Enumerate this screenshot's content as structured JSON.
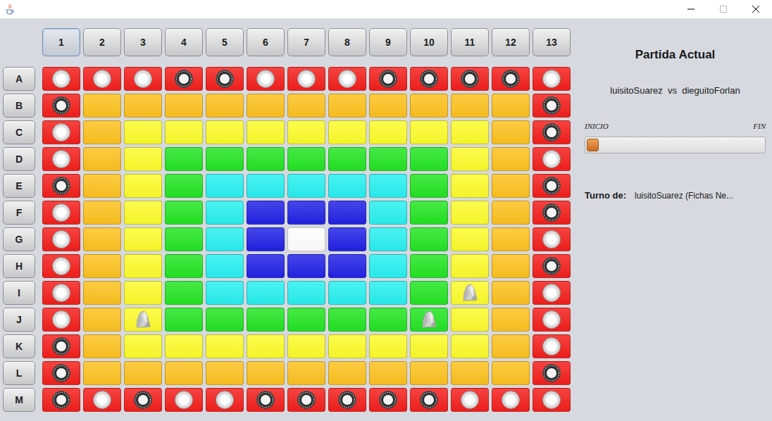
{
  "window": {
    "title": ""
  },
  "columns": [
    {
      "label": "1",
      "focused": true
    },
    {
      "label": "2",
      "focused": false
    },
    {
      "label": "3",
      "focused": false
    },
    {
      "label": "4",
      "focused": false
    },
    {
      "label": "5",
      "focused": false
    },
    {
      "label": "6",
      "focused": false
    },
    {
      "label": "7",
      "focused": false
    },
    {
      "label": "8",
      "focused": false
    },
    {
      "label": "9",
      "focused": false
    },
    {
      "label": "10",
      "focused": false
    },
    {
      "label": "11",
      "focused": false
    },
    {
      "label": "12",
      "focused": false
    },
    {
      "label": "13",
      "focused": false
    }
  ],
  "rows": [
    {
      "label": "A",
      "cells": [
        {
          "color": "#f41f1c",
          "piece": "white"
        },
        {
          "color": "#f41f1c",
          "piece": "white"
        },
        {
          "color": "#f41f1c",
          "piece": "white"
        },
        {
          "color": "#f41f1c",
          "piece": "black"
        },
        {
          "color": "#f41f1c",
          "piece": "black"
        },
        {
          "color": "#f41f1c",
          "piece": "white"
        },
        {
          "color": "#f41f1c",
          "piece": "white"
        },
        {
          "color": "#f41f1c",
          "piece": "white"
        },
        {
          "color": "#f41f1c",
          "piece": "black"
        },
        {
          "color": "#f41f1c",
          "piece": "black"
        },
        {
          "color": "#f41f1c",
          "piece": "black"
        },
        {
          "color": "#f41f1c",
          "piece": "black"
        },
        {
          "color": "#f41f1c",
          "piece": "white"
        }
      ]
    },
    {
      "label": "B",
      "cells": [
        {
          "color": "#f41f1c",
          "piece": "black"
        },
        {
          "color": "#fec21f",
          "piece": "none"
        },
        {
          "color": "#fec21f",
          "piece": "none"
        },
        {
          "color": "#fec21f",
          "piece": "none"
        },
        {
          "color": "#fec21f",
          "piece": "none"
        },
        {
          "color": "#fec21f",
          "piece": "none"
        },
        {
          "color": "#fec21f",
          "piece": "none"
        },
        {
          "color": "#fec21f",
          "piece": "none"
        },
        {
          "color": "#fec21f",
          "piece": "none"
        },
        {
          "color": "#fec21f",
          "piece": "none"
        },
        {
          "color": "#fec21f",
          "piece": "none"
        },
        {
          "color": "#fec21f",
          "piece": "none"
        },
        {
          "color": "#f41f1c",
          "piece": "black"
        }
      ]
    },
    {
      "label": "C",
      "cells": [
        {
          "color": "#f41f1c",
          "piece": "white"
        },
        {
          "color": "#fec21f",
          "piece": "none"
        },
        {
          "color": "#fdfc2b",
          "piece": "none"
        },
        {
          "color": "#fdfc2b",
          "piece": "none"
        },
        {
          "color": "#fdfc2b",
          "piece": "none"
        },
        {
          "color": "#fdfc2b",
          "piece": "none"
        },
        {
          "color": "#fdfc2b",
          "piece": "none"
        },
        {
          "color": "#fdfc2b",
          "piece": "none"
        },
        {
          "color": "#fdfc2b",
          "piece": "none"
        },
        {
          "color": "#fdfc2b",
          "piece": "none"
        },
        {
          "color": "#fdfc2b",
          "piece": "none"
        },
        {
          "color": "#fec21f",
          "piece": "none"
        },
        {
          "color": "#f41f1c",
          "piece": "black"
        }
      ]
    },
    {
      "label": "D",
      "cells": [
        {
          "color": "#f41f1c",
          "piece": "white"
        },
        {
          "color": "#fec21f",
          "piece": "none"
        },
        {
          "color": "#fdfc2b",
          "piece": "none"
        },
        {
          "color": "#23e523",
          "piece": "none"
        },
        {
          "color": "#23e523",
          "piece": "none"
        },
        {
          "color": "#23e523",
          "piece": "none"
        },
        {
          "color": "#23e523",
          "piece": "none"
        },
        {
          "color": "#23e523",
          "piece": "none"
        },
        {
          "color": "#23e523",
          "piece": "none"
        },
        {
          "color": "#23e523",
          "piece": "none"
        },
        {
          "color": "#fdfc2b",
          "piece": "none"
        },
        {
          "color": "#fec21f",
          "piece": "none"
        },
        {
          "color": "#f41f1c",
          "piece": "white"
        }
      ]
    },
    {
      "label": "E",
      "cells": [
        {
          "color": "#f41f1c",
          "piece": "black"
        },
        {
          "color": "#fec21f",
          "piece": "none"
        },
        {
          "color": "#fdfc2b",
          "piece": "none"
        },
        {
          "color": "#23e523",
          "piece": "none"
        },
        {
          "color": "#29f0f0",
          "piece": "none"
        },
        {
          "color": "#29f0f0",
          "piece": "none"
        },
        {
          "color": "#29f0f0",
          "piece": "none"
        },
        {
          "color": "#29f0f0",
          "piece": "none"
        },
        {
          "color": "#29f0f0",
          "piece": "none"
        },
        {
          "color": "#23e523",
          "piece": "none"
        },
        {
          "color": "#fdfc2b",
          "piece": "none"
        },
        {
          "color": "#fec21f",
          "piece": "none"
        },
        {
          "color": "#f41f1c",
          "piece": "black"
        }
      ]
    },
    {
      "label": "F",
      "cells": [
        {
          "color": "#f41f1c",
          "piece": "white"
        },
        {
          "color": "#fec21f",
          "piece": "none"
        },
        {
          "color": "#fdfc2b",
          "piece": "none"
        },
        {
          "color": "#23e523",
          "piece": "none"
        },
        {
          "color": "#29f0f0",
          "piece": "none"
        },
        {
          "color": "#2222e6",
          "piece": "none"
        },
        {
          "color": "#2222e6",
          "piece": "none"
        },
        {
          "color": "#2222e6",
          "piece": "none"
        },
        {
          "color": "#29f0f0",
          "piece": "none"
        },
        {
          "color": "#23e523",
          "piece": "none"
        },
        {
          "color": "#fdfc2b",
          "piece": "none"
        },
        {
          "color": "#fec21f",
          "piece": "none"
        },
        {
          "color": "#f41f1c",
          "piece": "black"
        }
      ]
    },
    {
      "label": "G",
      "cells": [
        {
          "color": "#f41f1c",
          "piece": "white"
        },
        {
          "color": "#fec21f",
          "piece": "none"
        },
        {
          "color": "#fdfc2b",
          "piece": "none"
        },
        {
          "color": "#23e523",
          "piece": "none"
        },
        {
          "color": "#29f0f0",
          "piece": "none"
        },
        {
          "color": "#2222e6",
          "piece": "none"
        },
        {
          "color": "#ffffff",
          "piece": "none"
        },
        {
          "color": "#2222e6",
          "piece": "none"
        },
        {
          "color": "#29f0f0",
          "piece": "none"
        },
        {
          "color": "#23e523",
          "piece": "none"
        },
        {
          "color": "#fdfc2b",
          "piece": "none"
        },
        {
          "color": "#fec21f",
          "piece": "none"
        },
        {
          "color": "#f41f1c",
          "piece": "white"
        }
      ]
    },
    {
      "label": "H",
      "cells": [
        {
          "color": "#f41f1c",
          "piece": "white"
        },
        {
          "color": "#fec21f",
          "piece": "none"
        },
        {
          "color": "#fdfc2b",
          "piece": "none"
        },
        {
          "color": "#23e523",
          "piece": "none"
        },
        {
          "color": "#29f0f0",
          "piece": "none"
        },
        {
          "color": "#2222e6",
          "piece": "none"
        },
        {
          "color": "#2222e6",
          "piece": "none"
        },
        {
          "color": "#2222e6",
          "piece": "none"
        },
        {
          "color": "#29f0f0",
          "piece": "none"
        },
        {
          "color": "#23e523",
          "piece": "none"
        },
        {
          "color": "#fdfc2b",
          "piece": "none"
        },
        {
          "color": "#fec21f",
          "piece": "none"
        },
        {
          "color": "#f41f1c",
          "piece": "black"
        }
      ]
    },
    {
      "label": "I",
      "cells": [
        {
          "color": "#f41f1c",
          "piece": "white"
        },
        {
          "color": "#fec21f",
          "piece": "none"
        },
        {
          "color": "#fdfc2b",
          "piece": "none"
        },
        {
          "color": "#23e523",
          "piece": "none"
        },
        {
          "color": "#29f0f0",
          "piece": "none"
        },
        {
          "color": "#29f0f0",
          "piece": "none"
        },
        {
          "color": "#29f0f0",
          "piece": "none"
        },
        {
          "color": "#29f0f0",
          "piece": "none"
        },
        {
          "color": "#29f0f0",
          "piece": "none"
        },
        {
          "color": "#23e523",
          "piece": "none"
        },
        {
          "color": "#fdfc2b",
          "piece": "stone"
        },
        {
          "color": "#fec21f",
          "piece": "none"
        },
        {
          "color": "#f41f1c",
          "piece": "white"
        }
      ]
    },
    {
      "label": "J",
      "cells": [
        {
          "color": "#f41f1c",
          "piece": "white"
        },
        {
          "color": "#fec21f",
          "piece": "none"
        },
        {
          "color": "#fdfc2b",
          "piece": "stone"
        },
        {
          "color": "#23e523",
          "piece": "none"
        },
        {
          "color": "#23e523",
          "piece": "none"
        },
        {
          "color": "#23e523",
          "piece": "none"
        },
        {
          "color": "#23e523",
          "piece": "none"
        },
        {
          "color": "#23e523",
          "piece": "none"
        },
        {
          "color": "#23e523",
          "piece": "none"
        },
        {
          "color": "#23e523",
          "piece": "stone"
        },
        {
          "color": "#fdfc2b",
          "piece": "none"
        },
        {
          "color": "#fec21f",
          "piece": "none"
        },
        {
          "color": "#f41f1c",
          "piece": "white"
        }
      ]
    },
    {
      "label": "K",
      "cells": [
        {
          "color": "#f41f1c",
          "piece": "black"
        },
        {
          "color": "#fec21f",
          "piece": "none"
        },
        {
          "color": "#fdfc2b",
          "piece": "none"
        },
        {
          "color": "#fdfc2b",
          "piece": "none"
        },
        {
          "color": "#fdfc2b",
          "piece": "none"
        },
        {
          "color": "#fdfc2b",
          "piece": "none"
        },
        {
          "color": "#fdfc2b",
          "piece": "none"
        },
        {
          "color": "#fdfc2b",
          "piece": "none"
        },
        {
          "color": "#fdfc2b",
          "piece": "none"
        },
        {
          "color": "#fdfc2b",
          "piece": "none"
        },
        {
          "color": "#fdfc2b",
          "piece": "none"
        },
        {
          "color": "#fec21f",
          "piece": "none"
        },
        {
          "color": "#f41f1c",
          "piece": "white"
        }
      ]
    },
    {
      "label": "L",
      "cells": [
        {
          "color": "#f41f1c",
          "piece": "black"
        },
        {
          "color": "#fec21f",
          "piece": "none"
        },
        {
          "color": "#fec21f",
          "piece": "none"
        },
        {
          "color": "#fec21f",
          "piece": "none"
        },
        {
          "color": "#fec21f",
          "piece": "none"
        },
        {
          "color": "#fec21f",
          "piece": "none"
        },
        {
          "color": "#fec21f",
          "piece": "none"
        },
        {
          "color": "#fec21f",
          "piece": "none"
        },
        {
          "color": "#fec21f",
          "piece": "none"
        },
        {
          "color": "#fec21f",
          "piece": "none"
        },
        {
          "color": "#fec21f",
          "piece": "none"
        },
        {
          "color": "#fec21f",
          "piece": "none"
        },
        {
          "color": "#f41f1c",
          "piece": "black"
        }
      ]
    },
    {
      "label": "M",
      "cells": [
        {
          "color": "#f41f1c",
          "piece": "black"
        },
        {
          "color": "#f41f1c",
          "piece": "white"
        },
        {
          "color": "#f41f1c",
          "piece": "black"
        },
        {
          "color": "#f41f1c",
          "piece": "white"
        },
        {
          "color": "#f41f1c",
          "piece": "white"
        },
        {
          "color": "#f41f1c",
          "piece": "black"
        },
        {
          "color": "#f41f1c",
          "piece": "black"
        },
        {
          "color": "#f41f1c",
          "piece": "black"
        },
        {
          "color": "#f41f1c",
          "piece": "black"
        },
        {
          "color": "#f41f1c",
          "piece": "black"
        },
        {
          "color": "#f41f1c",
          "piece": "white"
        },
        {
          "color": "#f41f1c",
          "piece": "white"
        },
        {
          "color": "#f41f1c",
          "piece": "white"
        }
      ]
    }
  ],
  "panel": {
    "title": "Partida Actual",
    "players": "luisitoSuarez  vs  dieguitoForlan",
    "slider": {
      "start_label": "INICIO",
      "end_label": "FIN",
      "level": 0
    },
    "turn_label": "Turno de:",
    "turn_value": "luisitoSuarez (Fichas Ne..."
  }
}
